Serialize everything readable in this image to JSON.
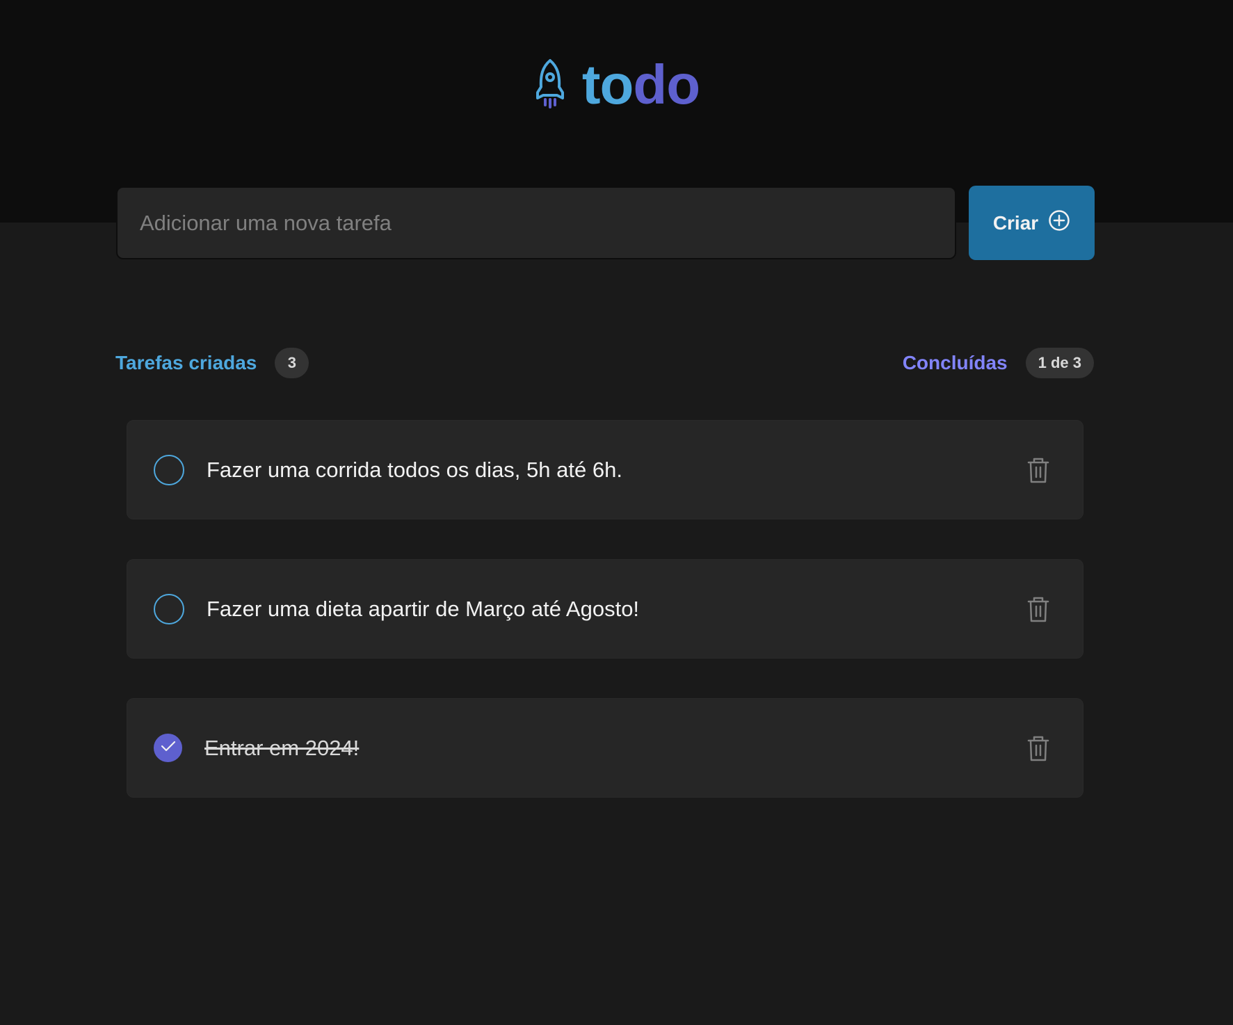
{
  "app": {
    "logo_part1": "to",
    "logo_part2": "do",
    "icon": "rocket-icon",
    "colors": {
      "blue": "#4ea8de",
      "purple": "#5e60ce",
      "purple_light": "#8284fa",
      "button_blue": "#1e6f9f",
      "background": "#1a1a1a",
      "header_background": "#0d0d0d",
      "card": "#262626"
    }
  },
  "new_task": {
    "placeholder": "Adicionar uma nova tarefa",
    "value": "",
    "button_label": "Criar",
    "button_icon": "plus-circle-icon"
  },
  "counters": {
    "created_label": "Tarefas criadas",
    "created_count": "3",
    "done_label": "Concluídas",
    "done_count": "1 de 3"
  },
  "tasks": [
    {
      "text": "Fazer uma corrida todos os dias, 5h até 6h.",
      "completed": false,
      "delete_icon": "trash-icon"
    },
    {
      "text": "Fazer uma dieta apartir de Março até Agosto!",
      "completed": false,
      "delete_icon": "trash-icon"
    },
    {
      "text": "Entrar em 2024!",
      "completed": true,
      "delete_icon": "trash-icon"
    }
  ]
}
